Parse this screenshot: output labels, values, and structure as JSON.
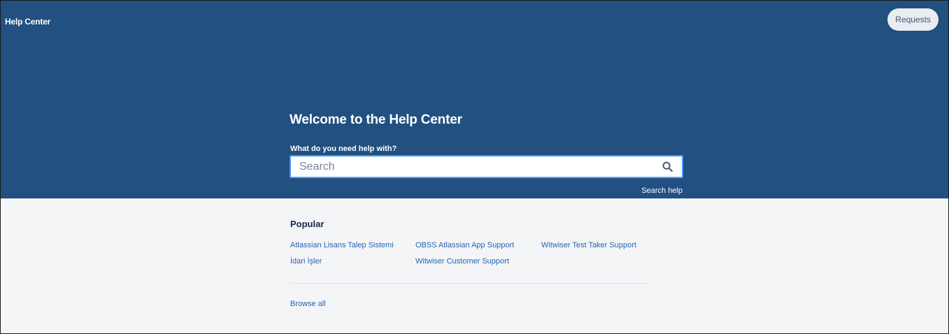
{
  "header": {
    "brand": "Help Center",
    "requests_label": "Requests"
  },
  "hero": {
    "title": "Welcome to the Help Center",
    "search_label": "What do you need help with?",
    "search_placeholder": "Search",
    "search_help": "Search help"
  },
  "popular": {
    "title": "Popular",
    "items": [
      {
        "label": "Atlassian Lisans Talep Sistemi"
      },
      {
        "label": "OBSS Atlassian App Support"
      },
      {
        "label": "Witwiser Test Taker Support"
      },
      {
        "label": "İdari İşler"
      },
      {
        "label": "Witwiser Customer Support"
      }
    ],
    "browse_all": "Browse all"
  },
  "colors": {
    "hero_bg": "#215081",
    "page_bg": "#f4f5f7",
    "link": "#2563b8",
    "search_border": "#4c9aff"
  },
  "icons": {
    "search": "search-icon"
  }
}
